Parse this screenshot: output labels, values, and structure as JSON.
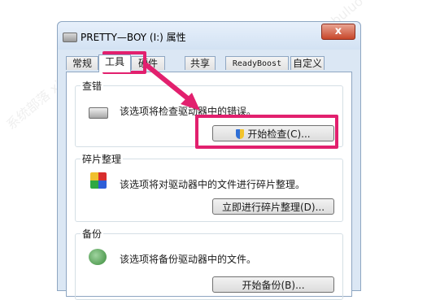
{
  "window": {
    "title": "PRETTY—BOY (I:) 属性",
    "close_label": "x"
  },
  "tabs": [
    {
      "label": "常规"
    },
    {
      "label": "工具"
    },
    {
      "label": "硬件"
    },
    {
      "label": "共享"
    },
    {
      "label": "ReadyBoost"
    },
    {
      "label": "自定义"
    }
  ],
  "groups": {
    "check": {
      "label": "查错",
      "text": "该选项将检查驱动器中的错误。",
      "button": "开始检查(C)..."
    },
    "defrag": {
      "label": "碎片整理",
      "text": "该选项将对驱动器中的文件进行碎片整理。",
      "button": "立即进行碎片整理(D)..."
    },
    "backup": {
      "label": "备份",
      "text": "该选项将备份驱动器中的文件。",
      "button": "开始备份(B)..."
    }
  },
  "annotation": {
    "color": "#e2206e"
  }
}
